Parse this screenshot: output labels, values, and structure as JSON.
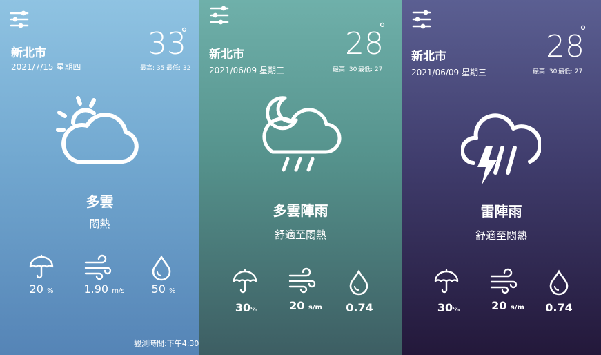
{
  "cards": [
    {
      "city": "新北市",
      "date": "2021/7/15 星期四",
      "temperature": "33",
      "degree": "°",
      "high_label": "最高: 35",
      "low_label": "最低: 32",
      "condition": "多雲",
      "feel": "悶熱",
      "rain_value": "20",
      "rain_unit": "%",
      "wind_value": "1.90",
      "wind_unit": "m/s",
      "humidity_value": "50",
      "humidity_unit": "%",
      "observed": "觀測時間:下午4:30",
      "weather_icon": "partly-sunny-icon"
    },
    {
      "city": "新北市",
      "date": "2021/06/09 星期三",
      "temperature": "28",
      "degree": "°",
      "high_label": "最高: 30",
      "low_label": "最低: 27",
      "condition": "多雲陣雨",
      "feel": "舒適至悶熱",
      "rain_value": "30",
      "rain_unit": "%",
      "wind_value": "20",
      "wind_unit": "s/m",
      "humidity_value": "0.74",
      "humidity_unit": "",
      "weather_icon": "night-rain-icon"
    },
    {
      "city": "新北市",
      "date": "2021/06/09 星期三",
      "temperature": "28",
      "degree": "°",
      "high_label": "最高: 30",
      "low_label": "最低: 27",
      "condition": "雷陣雨",
      "feel": "舒適至悶熱",
      "rain_value": "30",
      "rain_unit": "%",
      "wind_value": "20",
      "wind_unit": "s/m",
      "humidity_value": "0.74",
      "humidity_unit": "",
      "weather_icon": "thunderstorm-icon"
    }
  ],
  "icons": {
    "settings": "sliders-icon",
    "rain": "umbrella-icon",
    "wind": "wind-icon",
    "humidity": "droplet-icon"
  }
}
